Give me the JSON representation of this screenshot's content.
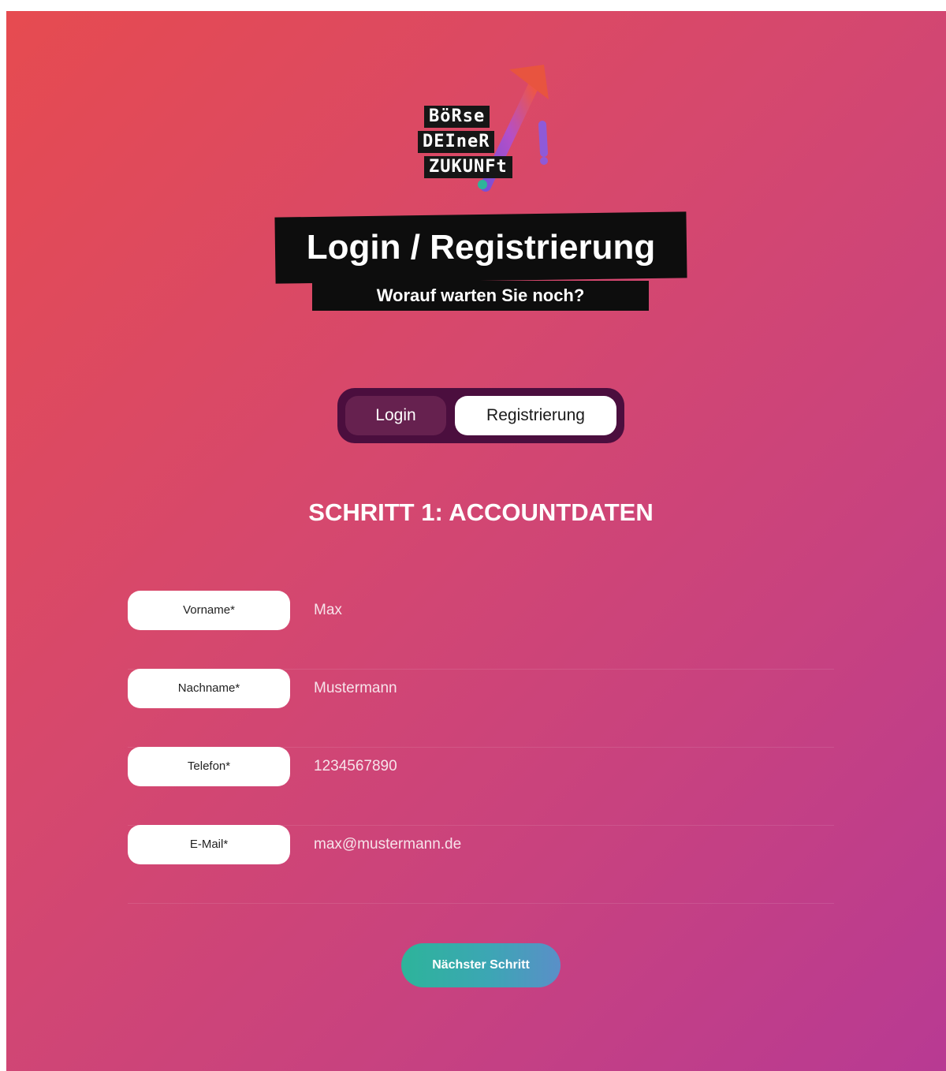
{
  "logo": {
    "line1": "BöRse",
    "line2": "DEIneR",
    "line3": "ZUKUNFt"
  },
  "header": {
    "title": "Login / Registrierung",
    "subtitle": "Worauf warten Sie noch?"
  },
  "tabs": {
    "login_label": "Login",
    "register_label": "Registrierung",
    "active": "Registrierung"
  },
  "step": {
    "heading": "SCHRITT 1: ACCOUNTDATEN"
  },
  "form": {
    "fields": [
      {
        "label": "Vorname*",
        "value": "Max"
      },
      {
        "label": "Nachname*",
        "value": "Mustermann"
      },
      {
        "label": "Telefon*",
        "value": "1234567890"
      },
      {
        "label": "E-Mail*",
        "value": "max@mustermann.de"
      }
    ]
  },
  "actions": {
    "next_label": "Nächster Schritt"
  },
  "colors": {
    "gradient_start": "#e64b50",
    "gradient_end": "#b83a93",
    "tab_track": "#4b0e3e",
    "button_start": "#2db49a",
    "button_end": "#5a8fc8"
  }
}
